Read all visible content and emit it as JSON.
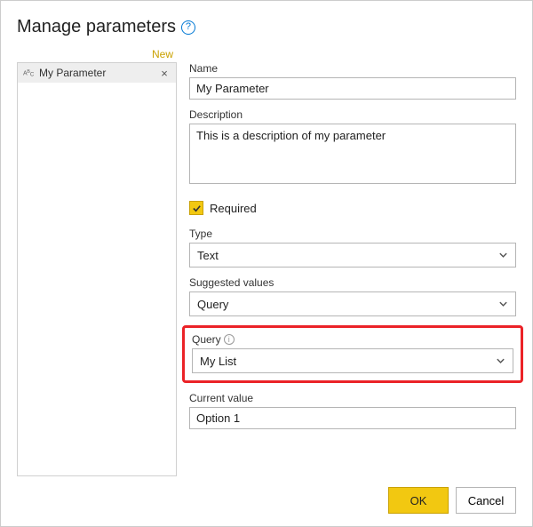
{
  "header": {
    "title": "Manage parameters",
    "help_glyph": "?"
  },
  "sidebar": {
    "new_label": "New",
    "items": [
      {
        "icon": "ABC",
        "label": "My Parameter",
        "close_glyph": "×"
      }
    ]
  },
  "form": {
    "name_label": "Name",
    "name_value": "My Parameter",
    "description_label": "Description",
    "description_value": "This is a description of my parameter",
    "required_label": "Required",
    "required_checked": true,
    "type_label": "Type",
    "type_value": "Text",
    "suggested_label": "Suggested values",
    "suggested_value": "Query",
    "query_label": "Query",
    "query_info_glyph": "i",
    "query_value": "My List",
    "current_label": "Current value",
    "current_value": "Option 1"
  },
  "footer": {
    "ok_label": "OK",
    "cancel_label": "Cancel"
  }
}
